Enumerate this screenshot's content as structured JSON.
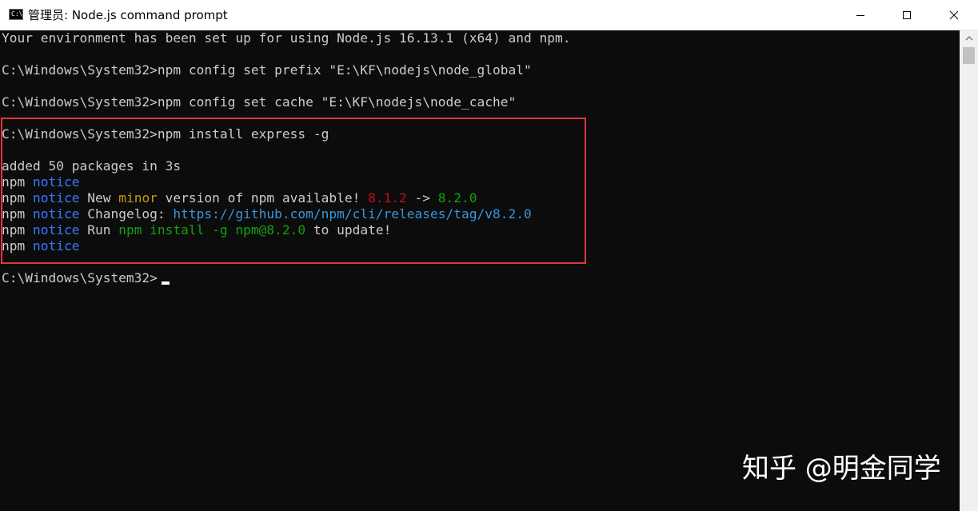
{
  "window": {
    "title": "管理员: Node.js command prompt",
    "app_icon_text": "C:\\"
  },
  "console": {
    "lines": [
      {
        "segments": [
          {
            "text": "Your environment has been set up for using Node.js 16.13.1 (x64) and npm."
          }
        ]
      },
      {
        "segments": [
          {
            "text": "C:\\Windows\\System32>npm config set prefix \"E:\\KF\\nodejs\\node_global\""
          }
        ]
      },
      {
        "segments": [
          {
            "text": "C:\\Windows\\System32>npm config set cache \"E:\\KF\\nodejs\\node_cache\""
          }
        ]
      },
      {
        "segments": [
          {
            "text": "C:\\Windows\\System32>npm install express -g"
          }
        ]
      },
      {
        "segments": [
          {
            "text": "added 50 packages in 3s"
          }
        ]
      },
      {
        "segments": [
          {
            "text": "npm "
          },
          {
            "text": "notice"
          }
        ]
      },
      {
        "segments": [
          {
            "text": "npm "
          },
          {
            "text": "notice"
          },
          {
            "text": " New "
          },
          {
            "text": "minor"
          },
          {
            "text": " version of npm available! "
          },
          {
            "text": "8.1.2"
          },
          {
            "text": " -> "
          },
          {
            "text": "8.2.0"
          }
        ]
      },
      {
        "segments": [
          {
            "text": "npm "
          },
          {
            "text": "notice"
          },
          {
            "text": " Changelog: "
          },
          {
            "text": "https://github.com/npm/cli/releases/tag/v8.2.0"
          }
        ]
      },
      {
        "segments": [
          {
            "text": "npm "
          },
          {
            "text": "notice"
          },
          {
            "text": " Run "
          },
          {
            "text": "npm install -g npm@8.2.0"
          },
          {
            "text": " to update!"
          }
        ]
      },
      {
        "segments": [
          {
            "text": "npm "
          },
          {
            "text": "notice"
          }
        ]
      },
      {
        "segments": [
          {
            "text": "C:\\Windows\\System32>"
          }
        ]
      }
    ]
  },
  "colors": {
    "background": "#0c0c0c",
    "foreground": "#cccccc",
    "notice_blue": "#3b78ff",
    "minor_yellow": "#c19c00",
    "old_version_red": "#c50f1f",
    "new_version_green": "#13a10e",
    "link_cyan": "#3a96dd",
    "highlight_box_red": "#e0363e"
  },
  "watermark": {
    "text": "知乎 @明金同学"
  },
  "icons": {
    "minimize": "minimize-icon",
    "maximize": "maximize-icon",
    "close": "close-icon",
    "scroll_up": "chevron-up-icon"
  }
}
